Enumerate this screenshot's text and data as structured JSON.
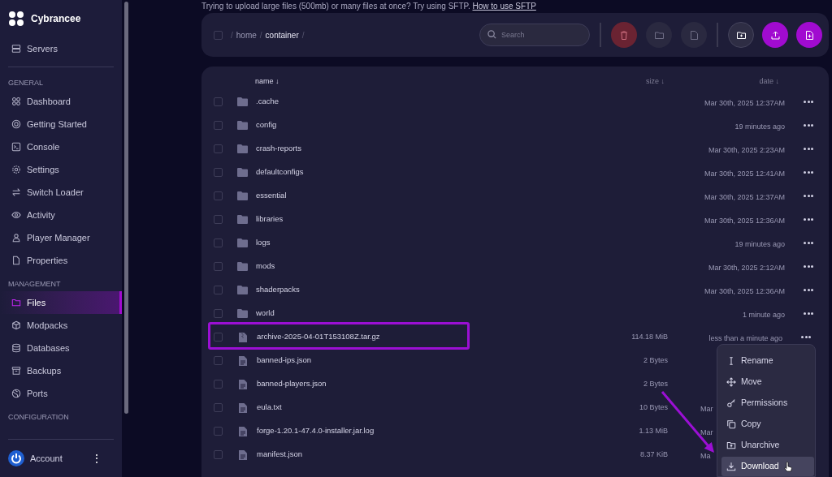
{
  "sidebar": {
    "brand": "Cybrancee",
    "top_item": {
      "label": "Servers",
      "selected": false
    },
    "sections": [
      {
        "title": "GENERAL",
        "items": [
          {
            "label": "Dashboard",
            "selected": false
          },
          {
            "label": "Getting Started",
            "selected": false
          },
          {
            "label": "Console",
            "selected": false
          },
          {
            "label": "Settings",
            "selected": false
          },
          {
            "label": "Switch Loader",
            "selected": false
          },
          {
            "label": "Activity",
            "selected": false
          },
          {
            "label": "Player Manager",
            "selected": false
          },
          {
            "label": "Properties",
            "selected": false
          }
        ]
      },
      {
        "title": "MANAGEMENT",
        "items": [
          {
            "label": "Files",
            "selected": true
          },
          {
            "label": "Modpacks",
            "selected": false
          },
          {
            "label": "Databases",
            "selected": false
          },
          {
            "label": "Backups",
            "selected": false
          },
          {
            "label": "Ports",
            "selected": false
          }
        ]
      },
      {
        "title": "CONFIGURATION"
      }
    ],
    "account": {
      "label": "Account",
      "menu": "⋮"
    }
  },
  "notice": {
    "text": "Trying to upload large files (500mb) or many files at once? Try using SFTP.",
    "link": "How to use SFTP"
  },
  "toolbar": {
    "select_all": {
      "checked": false
    },
    "path_separator": "/",
    "path": [
      "home",
      "container"
    ],
    "search": {
      "placeholder": "Search"
    }
  },
  "table": {
    "columns": [
      {
        "label": "name ↓"
      },
      {
        "label": "size ↓"
      },
      {
        "label": "date ↓"
      }
    ],
    "rows": [
      {
        "kind": "folder",
        "checked": false,
        "name": ".cache",
        "date": "Mar 30th, 2025 12:37AM"
      },
      {
        "kind": "folder",
        "checked": false,
        "name": "config",
        "date": "19 minutes ago"
      },
      {
        "kind": "folder",
        "checked": false,
        "name": "crash-reports",
        "date": "Mar 30th, 2025 2:23AM"
      },
      {
        "kind": "folder",
        "checked": false,
        "name": "defaultconfigs",
        "date": "Mar 30th, 2025 12:41AM"
      },
      {
        "kind": "folder",
        "checked": false,
        "name": "essential",
        "date": "Mar 30th, 2025 12:37AM"
      },
      {
        "kind": "folder",
        "checked": false,
        "name": "libraries",
        "date": "Mar 30th, 2025 12:36AM"
      },
      {
        "kind": "folder",
        "checked": false,
        "name": "logs",
        "date": "19 minutes ago"
      },
      {
        "kind": "folder",
        "checked": false,
        "name": "mods",
        "date": "Mar 30th, 2025 2:12AM"
      },
      {
        "kind": "folder",
        "checked": false,
        "name": "shaderpacks",
        "date": "Mar 30th, 2025 12:36AM"
      },
      {
        "kind": "folder",
        "checked": false,
        "name": "world",
        "date": "1 minute ago"
      },
      {
        "kind": "archive",
        "checked": false,
        "name": "archive-2025-04-01T153108Z.tar.gz",
        "size": "114.18 MiB",
        "date": "less than a minute ago",
        "highlighted": true
      },
      {
        "kind": "file",
        "checked": false,
        "name": "banned-ips.json",
        "size": "2 Bytes"
      },
      {
        "kind": "file",
        "checked": false,
        "name": "banned-players.json",
        "size": "2 Bytes"
      },
      {
        "kind": "file",
        "checked": false,
        "name": "eula.txt",
        "size": "10 Bytes",
        "date": "Mar",
        "date_cut": true
      },
      {
        "kind": "file",
        "checked": false,
        "name": "forge-1.20.1-47.4.0-installer.jar.log",
        "size": "1.13 MiB",
        "date": "Mar",
        "date_cut": true
      },
      {
        "kind": "file",
        "checked": false,
        "name": "manifest.json",
        "size": "8.37 KiB",
        "date": "Ma",
        "date_cut": true
      }
    ]
  },
  "context_menu": {
    "items": [
      {
        "label": "Rename",
        "selected": false
      },
      {
        "label": "Move",
        "selected": false
      },
      {
        "label": "Permissions",
        "selected": false
      },
      {
        "label": "Copy",
        "selected": false
      },
      {
        "label": "Unarchive",
        "selected": false
      },
      {
        "label": "Download",
        "selected": true
      }
    ]
  }
}
